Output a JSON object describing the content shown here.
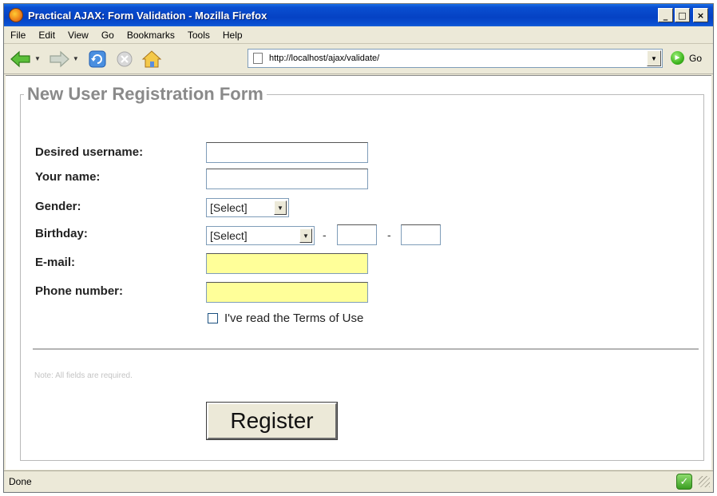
{
  "window": {
    "title": "Practical AJAX: Form Validation - Mozilla Firefox",
    "controls": {
      "minimize": "_",
      "maximize": "□",
      "close": "×"
    }
  },
  "menu": [
    "File",
    "Edit",
    "View",
    "Go",
    "Bookmarks",
    "Tools",
    "Help"
  ],
  "toolbar": {
    "back_icon": "back-arrow-icon",
    "forward_icon": "forward-arrow-icon",
    "reload_icon": "reload-icon",
    "stop_icon": "stop-icon",
    "home_icon": "home-icon",
    "url": "http://localhost/ajax/validate/",
    "go_label": "Go"
  },
  "form": {
    "legend": "New User Registration Form",
    "fields": {
      "username_label": "Desired username:",
      "name_label": "Your name:",
      "gender_label": "Gender:",
      "gender_value": "[Select]",
      "birthday_label": "Birthday:",
      "birthday_month_value": "[Select]",
      "birthday_sep": "-",
      "email_label": "E-mail:",
      "phone_label": "Phone number:",
      "terms_label": "I've read the Terms of Use"
    },
    "note": "Note: All fields are required.",
    "submit_label": "Register"
  },
  "status": {
    "text": "Done"
  },
  "colors": {
    "titlebar": "#0a4fd1",
    "highlight_field": "#ffff99",
    "legend": "#8a8a8a"
  }
}
